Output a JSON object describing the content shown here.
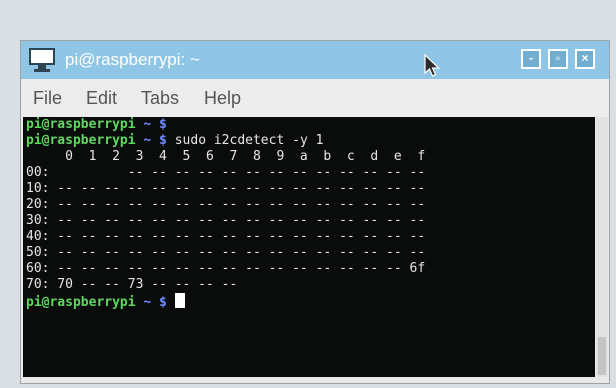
{
  "window": {
    "title": "pi@raspberrypi: ~",
    "icon": "terminal-icon",
    "controls": {
      "minimize": "-",
      "maximize": "▫",
      "close": "×"
    }
  },
  "menubar": {
    "file": "File",
    "edit": "Edit",
    "tabs": "Tabs",
    "help": "Help"
  },
  "terminal": {
    "prompt_user": "pi@raspberrypi",
    "prompt_path": " ~ $",
    "line1_cmd": "",
    "line2_cmd": " sudo i2cdetect -y 1",
    "header": "     0  1  2  3  4  5  6  7  8  9  a  b  c  d  e  f",
    "rows": [
      "00:          -- -- -- -- -- -- -- -- -- -- -- -- --",
      "10: -- -- -- -- -- -- -- -- -- -- -- -- -- -- -- --",
      "20: -- -- -- -- -- -- -- -- -- -- -- -- -- -- -- --",
      "30: -- -- -- -- -- -- -- -- -- -- -- -- -- -- -- --",
      "40: -- -- -- -- -- -- -- -- -- -- -- -- -- -- -- --",
      "50: -- -- -- -- -- -- -- -- -- -- -- -- -- -- -- --",
      "60: -- -- -- -- -- -- -- -- -- -- -- -- -- -- -- 6f",
      "70: 70 -- -- 73 -- -- -- --"
    ],
    "line_last_cmd": " "
  },
  "colors": {
    "titlebar": "#8fc6e6",
    "terminal_bg": "#0a0c0b",
    "prompt_user": "#5ed85e",
    "prompt_path": "#6f8cff"
  }
}
